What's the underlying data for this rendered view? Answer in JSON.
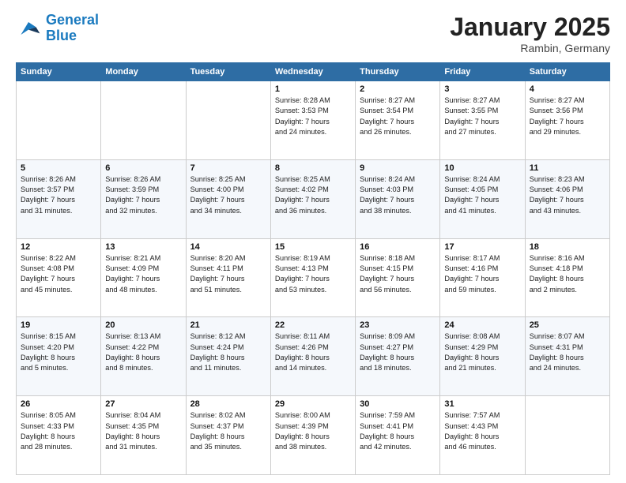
{
  "logo": {
    "line1": "General",
    "line2": "Blue"
  },
  "title": "January 2025",
  "subtitle": "Rambin, Germany",
  "days_of_week": [
    "Sunday",
    "Monday",
    "Tuesday",
    "Wednesday",
    "Thursday",
    "Friday",
    "Saturday"
  ],
  "weeks": [
    [
      {
        "day": "",
        "info": ""
      },
      {
        "day": "",
        "info": ""
      },
      {
        "day": "",
        "info": ""
      },
      {
        "day": "1",
        "info": "Sunrise: 8:28 AM\nSunset: 3:53 PM\nDaylight: 7 hours\nand 24 minutes."
      },
      {
        "day": "2",
        "info": "Sunrise: 8:27 AM\nSunset: 3:54 PM\nDaylight: 7 hours\nand 26 minutes."
      },
      {
        "day": "3",
        "info": "Sunrise: 8:27 AM\nSunset: 3:55 PM\nDaylight: 7 hours\nand 27 minutes."
      },
      {
        "day": "4",
        "info": "Sunrise: 8:27 AM\nSunset: 3:56 PM\nDaylight: 7 hours\nand 29 minutes."
      }
    ],
    [
      {
        "day": "5",
        "info": "Sunrise: 8:26 AM\nSunset: 3:57 PM\nDaylight: 7 hours\nand 31 minutes."
      },
      {
        "day": "6",
        "info": "Sunrise: 8:26 AM\nSunset: 3:59 PM\nDaylight: 7 hours\nand 32 minutes."
      },
      {
        "day": "7",
        "info": "Sunrise: 8:25 AM\nSunset: 4:00 PM\nDaylight: 7 hours\nand 34 minutes."
      },
      {
        "day": "8",
        "info": "Sunrise: 8:25 AM\nSunset: 4:02 PM\nDaylight: 7 hours\nand 36 minutes."
      },
      {
        "day": "9",
        "info": "Sunrise: 8:24 AM\nSunset: 4:03 PM\nDaylight: 7 hours\nand 38 minutes."
      },
      {
        "day": "10",
        "info": "Sunrise: 8:24 AM\nSunset: 4:05 PM\nDaylight: 7 hours\nand 41 minutes."
      },
      {
        "day": "11",
        "info": "Sunrise: 8:23 AM\nSunset: 4:06 PM\nDaylight: 7 hours\nand 43 minutes."
      }
    ],
    [
      {
        "day": "12",
        "info": "Sunrise: 8:22 AM\nSunset: 4:08 PM\nDaylight: 7 hours\nand 45 minutes."
      },
      {
        "day": "13",
        "info": "Sunrise: 8:21 AM\nSunset: 4:09 PM\nDaylight: 7 hours\nand 48 minutes."
      },
      {
        "day": "14",
        "info": "Sunrise: 8:20 AM\nSunset: 4:11 PM\nDaylight: 7 hours\nand 51 minutes."
      },
      {
        "day": "15",
        "info": "Sunrise: 8:19 AM\nSunset: 4:13 PM\nDaylight: 7 hours\nand 53 minutes."
      },
      {
        "day": "16",
        "info": "Sunrise: 8:18 AM\nSunset: 4:15 PM\nDaylight: 7 hours\nand 56 minutes."
      },
      {
        "day": "17",
        "info": "Sunrise: 8:17 AM\nSunset: 4:16 PM\nDaylight: 7 hours\nand 59 minutes."
      },
      {
        "day": "18",
        "info": "Sunrise: 8:16 AM\nSunset: 4:18 PM\nDaylight: 8 hours\nand 2 minutes."
      }
    ],
    [
      {
        "day": "19",
        "info": "Sunrise: 8:15 AM\nSunset: 4:20 PM\nDaylight: 8 hours\nand 5 minutes."
      },
      {
        "day": "20",
        "info": "Sunrise: 8:13 AM\nSunset: 4:22 PM\nDaylight: 8 hours\nand 8 minutes."
      },
      {
        "day": "21",
        "info": "Sunrise: 8:12 AM\nSunset: 4:24 PM\nDaylight: 8 hours\nand 11 minutes."
      },
      {
        "day": "22",
        "info": "Sunrise: 8:11 AM\nSunset: 4:26 PM\nDaylight: 8 hours\nand 14 minutes."
      },
      {
        "day": "23",
        "info": "Sunrise: 8:09 AM\nSunset: 4:27 PM\nDaylight: 8 hours\nand 18 minutes."
      },
      {
        "day": "24",
        "info": "Sunrise: 8:08 AM\nSunset: 4:29 PM\nDaylight: 8 hours\nand 21 minutes."
      },
      {
        "day": "25",
        "info": "Sunrise: 8:07 AM\nSunset: 4:31 PM\nDaylight: 8 hours\nand 24 minutes."
      }
    ],
    [
      {
        "day": "26",
        "info": "Sunrise: 8:05 AM\nSunset: 4:33 PM\nDaylight: 8 hours\nand 28 minutes."
      },
      {
        "day": "27",
        "info": "Sunrise: 8:04 AM\nSunset: 4:35 PM\nDaylight: 8 hours\nand 31 minutes."
      },
      {
        "day": "28",
        "info": "Sunrise: 8:02 AM\nSunset: 4:37 PM\nDaylight: 8 hours\nand 35 minutes."
      },
      {
        "day": "29",
        "info": "Sunrise: 8:00 AM\nSunset: 4:39 PM\nDaylight: 8 hours\nand 38 minutes."
      },
      {
        "day": "30",
        "info": "Sunrise: 7:59 AM\nSunset: 4:41 PM\nDaylight: 8 hours\nand 42 minutes."
      },
      {
        "day": "31",
        "info": "Sunrise: 7:57 AM\nSunset: 4:43 PM\nDaylight: 8 hours\nand 46 minutes."
      },
      {
        "day": "",
        "info": ""
      }
    ]
  ]
}
